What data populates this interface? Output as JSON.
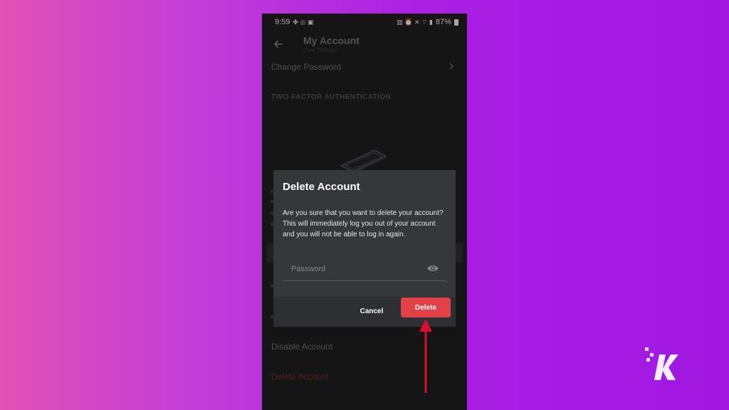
{
  "status_bar": {
    "time": "9:59",
    "battery": "87%"
  },
  "header": {
    "title": "My Account",
    "subtitle": "User Settings"
  },
  "settings": {
    "change_password": "Change Password",
    "section_2fa": "TWO-FACTOR AUTHENTICATION",
    "disable_account": "Disable Account",
    "delete_account": "Delete Account"
  },
  "dialog": {
    "title": "Delete Account",
    "body": "Are you sure that you want to delete your account? This will immediately log you out of your account and you will not be able to log in again.",
    "password_placeholder": "Password",
    "cancel_label": "Cancel",
    "delete_label": "Delete"
  },
  "colors": {
    "delete_button": "#e24145",
    "dialog_bg": "#36373b",
    "annotation_arrow": "#d8102a",
    "background_left": "#e052b4",
    "background_right": "#a018e0"
  },
  "icons": [
    "back-arrow-icon",
    "chevron-right-icon",
    "eye-icon",
    "phone-illustration-icon",
    "annotation-arrow-icon",
    "brand-logo-icon"
  ]
}
